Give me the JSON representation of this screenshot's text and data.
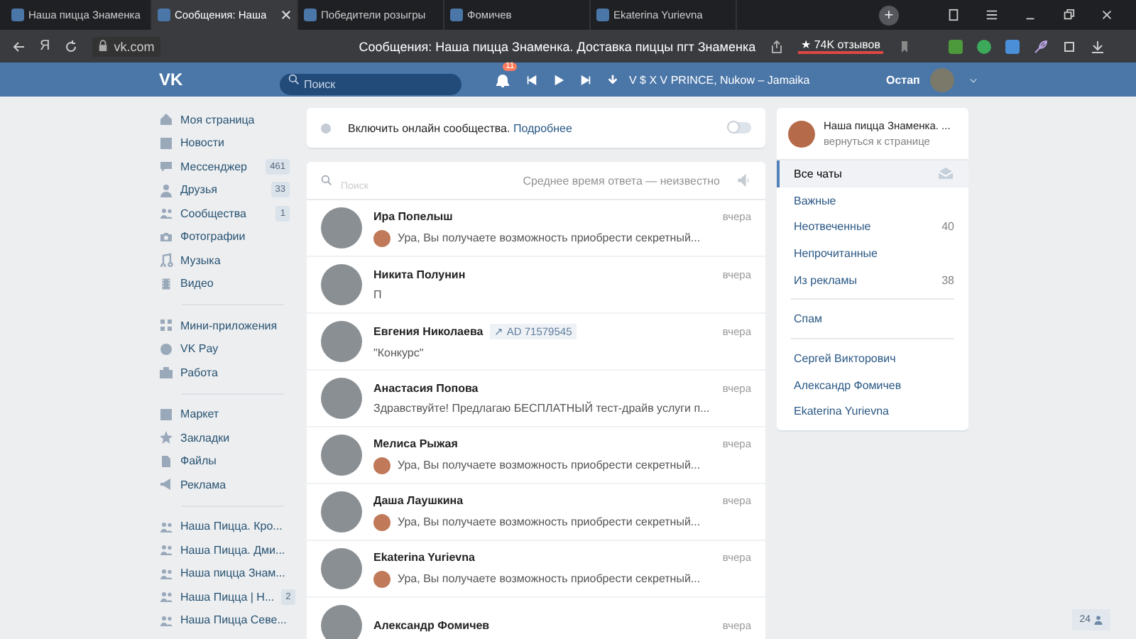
{
  "browser": {
    "tabs": [
      {
        "title": "Наша пицца Знаменка",
        "selected": false
      },
      {
        "title": "Сообщения: Наша",
        "selected": true
      },
      {
        "title": "Победители розыгры",
        "selected": false
      },
      {
        "title": "Фомичев",
        "selected": false
      },
      {
        "title": "Ekaterina Yurievna",
        "selected": false
      }
    ],
    "new_tab": "+",
    "address": "vk.com",
    "yandex": "Я",
    "page_title": "Сообщения: Наша пицца Знаменка. Доставка пиццы пгт Знаменка",
    "reviews": "★ 74K отзывов"
  },
  "header": {
    "logo": "VK",
    "search": {
      "placeholder": "Поиск"
    },
    "notifications": "11",
    "track": "V $ X V PRINCE, Nukow – Jamaika",
    "user": "Остап"
  },
  "sidebar": {
    "sections": [
      [
        {
          "label": "Моя страница"
        },
        {
          "label": "Новости"
        },
        {
          "label": "Мессенджер",
          "count": "461"
        },
        {
          "label": "Друзья",
          "count": "33"
        },
        {
          "label": "Сообщества",
          "count": "1"
        },
        {
          "label": "Фотографии"
        },
        {
          "label": "Музыка"
        },
        {
          "label": "Видео"
        }
      ],
      [
        {
          "label": "Мини-приложения"
        },
        {
          "label": "VK Pay"
        },
        {
          "label": "Работа"
        }
      ],
      [
        {
          "label": "Маркет"
        },
        {
          "label": "Закладки"
        },
        {
          "label": "Файлы"
        },
        {
          "label": "Реклама"
        }
      ],
      [
        {
          "label": "Наша Пицца. Кро..."
        },
        {
          "label": "Наша Пицца. Дми..."
        },
        {
          "label": "Наша пицца Знам..."
        },
        {
          "label": "Наша Пицца | Н...",
          "count": "2"
        },
        {
          "label": "Наша Пицца Севе..."
        }
      ]
    ]
  },
  "online": {
    "text": "Включить онлайн сообщества.",
    "link": "Подробнее",
    "on": false
  },
  "chats": {
    "search": {
      "placeholder": "Поиск"
    },
    "response_time": "Среднее время ответа — неизвестно",
    "rows": [
      {
        "name": "Ира Попелыш",
        "time": "вчера",
        "preview": "Ура, Вы получаете возможность приобрести секретный...",
        "preview_avatar": true
      },
      {
        "name": "Никита Полунин",
        "time": "вчера",
        "preview": "П",
        "preview_avatar": false
      },
      {
        "name": "Евгения Николаева",
        "tag": "↗ AD 71579545",
        "time": "вчера",
        "preview": "\"Конкурс\"",
        "preview_avatar": false
      },
      {
        "name": "Анастасия Попова",
        "time": "вчера",
        "preview": "Здравствуйте! Предлагаю БЕСПЛАТНЫЙ тест-драйв услуги п...",
        "preview_avatar": false
      },
      {
        "name": "Мелиса Рыжая",
        "time": "вчера",
        "preview": "Ура, Вы получаете возможность приобрести секретный...",
        "preview_avatar": true
      },
      {
        "name": "Даша Лаушкина",
        "time": "вчера",
        "preview": "Ура, Вы получаете возможность приобрести секретный...",
        "preview_avatar": true
      },
      {
        "name": "Ekaterina Yurievna",
        "time": "вчера",
        "preview": "Ура, Вы получаете возможность приобрести секретный...",
        "preview_avatar": true
      },
      {
        "name": "Александр Фомичев",
        "time": "вчера"
      }
    ]
  },
  "community": {
    "name": "Наша пицца Знаменка. ...",
    "back": "вернуться к странице"
  },
  "filters": [
    [
      {
        "label": "Все чаты",
        "selected": true
      },
      {
        "label": "Важные",
        "selected": false
      },
      {
        "label": "Неотвеченные",
        "count": "40",
        "selected": false
      },
      {
        "label": "Непрочитанные",
        "selected": false
      },
      {
        "label": "Из рекламы",
        "count": "38",
        "selected": false
      }
    ],
    [
      {
        "label": "Спам",
        "selected": false
      }
    ],
    [
      {
        "label": "Сергей Викторович",
        "selected": false
      },
      {
        "label": "Александр Фомичев",
        "selected": false
      },
      {
        "label": "Ekaterina Yurievna",
        "selected": false
      }
    ]
  ],
  "online_badge": "24"
}
